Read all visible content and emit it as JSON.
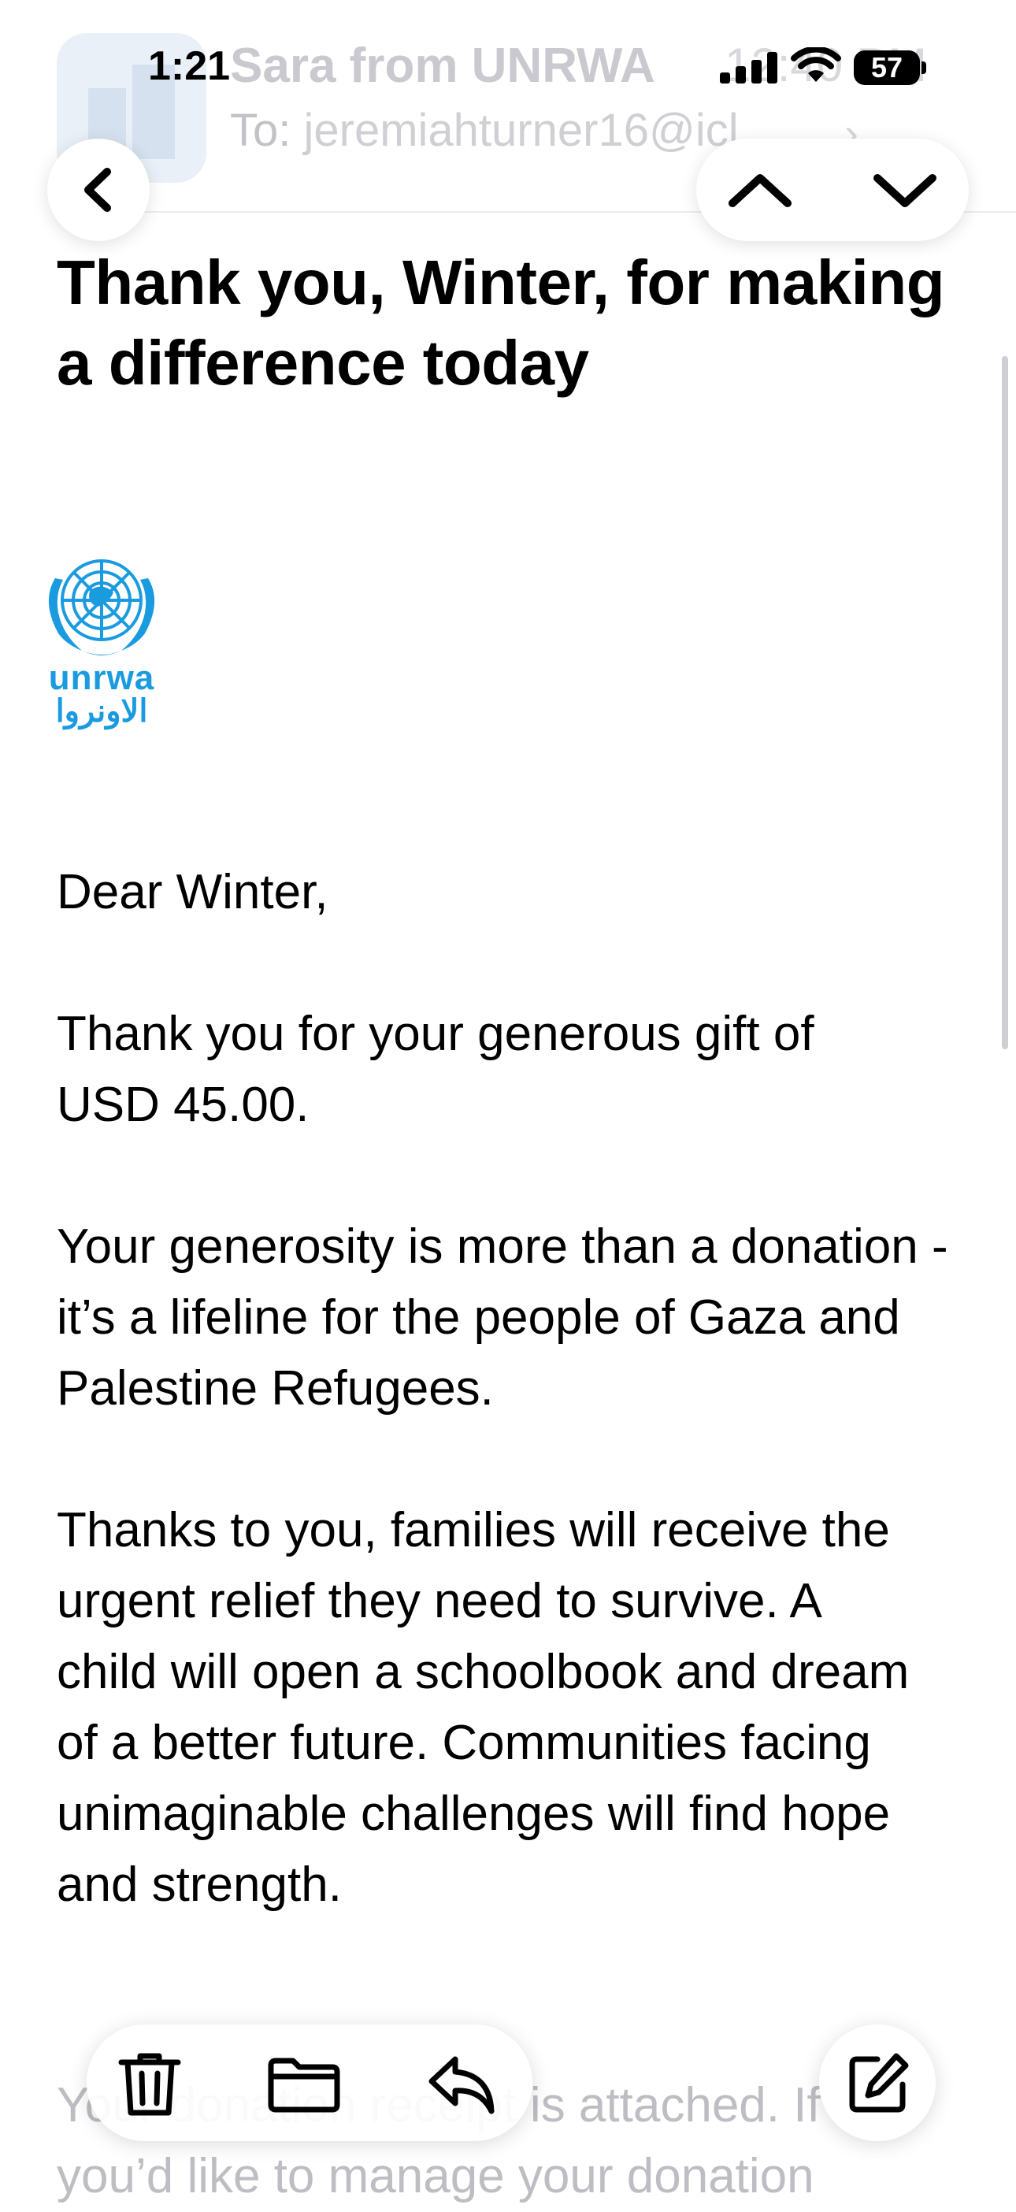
{
  "header": {
    "sender": "Sara from UNRWA",
    "time": "12:40 PM",
    "to_label": "To:",
    "to_address": "jeremiahturner16@icl"
  },
  "status_bar": {
    "time": "1:21",
    "battery": "57"
  },
  "nav": {
    "back_icon": "chevron-left-icon",
    "prev_icon": "chevron-up-icon",
    "next_icon": "chevron-down-icon"
  },
  "email": {
    "subject": "Thank you, Winter, for making a difference today",
    "logo_text_en": "unrwa",
    "logo_text_ar": "الاونروا",
    "greeting": "Dear Winter,",
    "paragraphs": [
      "Thank you for your generous gift of USD 45.00.",
      "Your generosity is more than a donation - it’s a lifeline for the people of Gaza and Palestine Refugees.",
      "Thanks to you, families will receive the urgent relief they need to survive. A child will open a schoolbook and dream of a better future. Communities facing unimaginable challenges will find hope and strength."
    ],
    "faded_paragraph": "Your donation receipt is attached. If you’d like to manage your donation"
  },
  "toolbar": {
    "icons": [
      "trash-icon",
      "folder-icon",
      "reply-icon"
    ],
    "compose_icon": "compose-icon"
  },
  "colors": {
    "unrwa_blue": "#1a9be0",
    "text": "#000000",
    "faded": "#c9c9cf"
  }
}
